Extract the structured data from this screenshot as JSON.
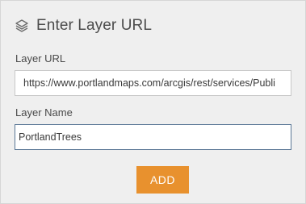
{
  "header": {
    "icon": "layers-icon",
    "title": "Enter Layer URL"
  },
  "form": {
    "url_label": "Layer URL",
    "url_value": "https://www.portlandmaps.com/arcgis/rest/services/Publi",
    "name_label": "Layer Name",
    "name_value": "PortlandTrees",
    "add_label": "ADD"
  },
  "colors": {
    "accent": "#e8912e",
    "focus_border": "#5a7795",
    "panel_bg": "#efefef"
  }
}
